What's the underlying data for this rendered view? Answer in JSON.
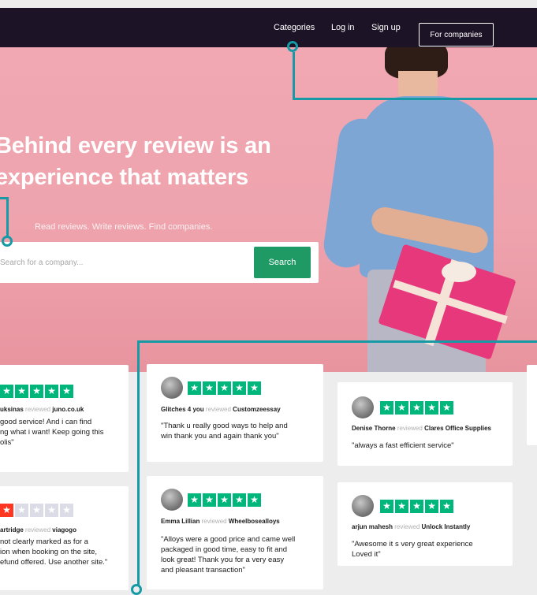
{
  "nav": {
    "categories": "Categories",
    "login": "Log in",
    "signup": "Sign up",
    "for_companies": "For companies"
  },
  "hero": {
    "title_line1": "Behind every review is an",
    "title_line2": "experience that matters",
    "subtitle": "Read reviews. Write reviews. Find companies.",
    "search_placeholder": "Search for a company...",
    "search_button": "Search"
  },
  "colors": {
    "nav_bg": "#1c1326",
    "hero_bg": "#f1a8b2",
    "search_button": "#1f9a65",
    "star_green": "#00b67a",
    "star_red": "#ff3722",
    "annotation": "#159aa6"
  },
  "reviews": [
    {
      "name": "uksinas",
      "reviewed": "reviewed",
      "company": "juno.co.uk",
      "stars": 5,
      "text_lines": [
        "good service! And i can find",
        "ng what i want! Keep going this",
        "olis\""
      ]
    },
    {
      "name": "artridge",
      "reviewed": "reviewed",
      "company": "viagogo",
      "stars": 1,
      "text_lines": [
        "not clearly marked as for a",
        "ion when booking on the site,",
        "efund offered. Use another site.\""
      ]
    },
    {
      "name": "Glitches 4 you",
      "reviewed": "reviewed",
      "company": "Customzeessay",
      "stars": 5,
      "text_lines": [
        "\"Thank u really good ways to help and",
        "win thank you and again thank you\""
      ]
    },
    {
      "name": "Emma Lillian",
      "reviewed": "reviewed",
      "company": "Wheelbosealloys",
      "stars": 5,
      "text_lines": [
        "\"Alloys were a good price and came well",
        "packaged in good time, easy to fit and",
        "look great! Thank you for a very easy",
        "and pleasant transaction\""
      ]
    },
    {
      "name": "Denise Thorne",
      "reviewed": "reviewed",
      "company": "Clares Office Supplies",
      "stars": 5,
      "text_lines": [
        "\"always a fast efficient service\""
      ]
    },
    {
      "name": "arjun mahesh",
      "reviewed": "reviewed",
      "company": "Unlock Instantly",
      "stars": 5,
      "text_lines": [
        "\"Awesome it s very great experience",
        "Loved it\""
      ]
    }
  ]
}
